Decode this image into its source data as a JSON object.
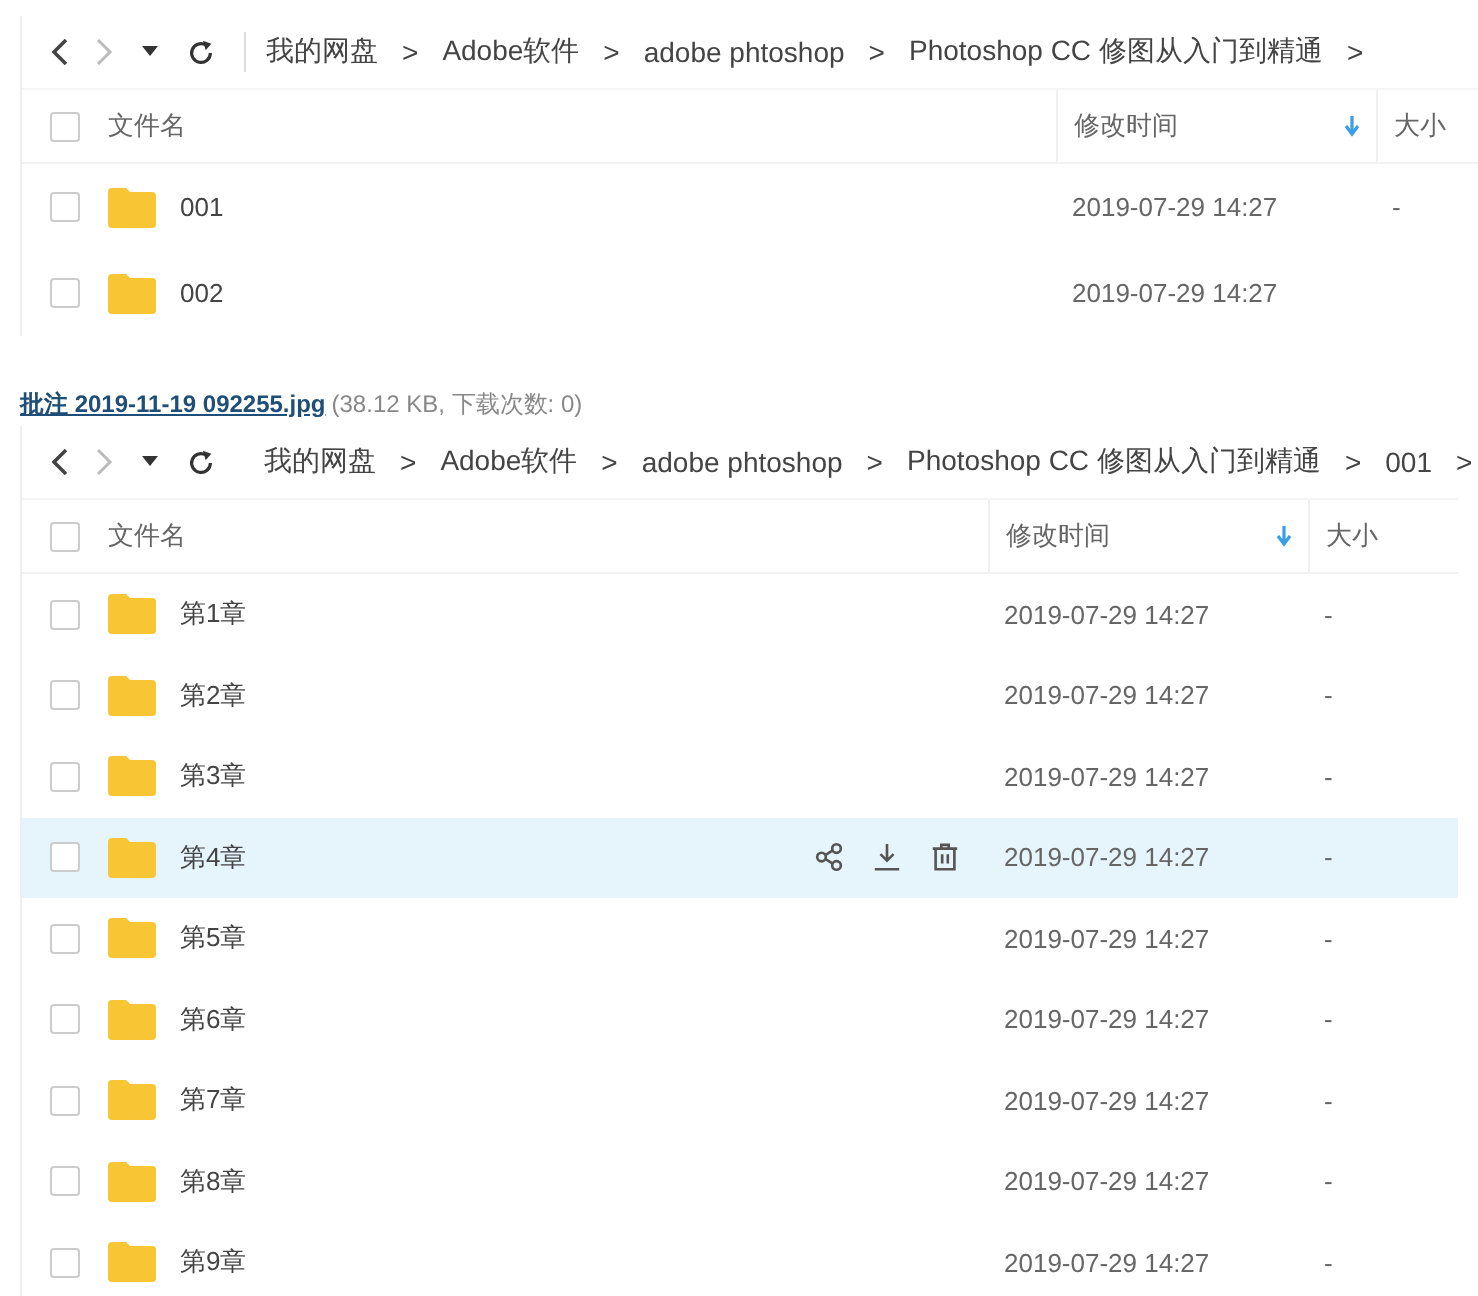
{
  "panels": [
    {
      "breadcrumb": [
        {
          "label": "我的网盘",
          "separator": ">"
        },
        {
          "label": "Adobe软件",
          "separator": ">"
        },
        {
          "label": "adobe phtoshop",
          "separator": ">"
        },
        {
          "label": "Photoshop CC 修图从入门到精通",
          "separator": ">"
        }
      ],
      "columns": [
        {
          "label": "文件名",
          "checked": false
        },
        {
          "label": "修改时间",
          "sorted": true
        },
        {
          "label": "大小"
        }
      ],
      "rows": [
        {
          "name": "001",
          "modified": "2019-07-29 14:27",
          "size": "-",
          "hovered": false,
          "checked": false
        },
        {
          "name": "002",
          "modified": "2019-07-29 14:27",
          "hovered": false,
          "checked": false
        }
      ]
    },
    {
      "caption": {
        "link": "批注 2019-11-19 092255.jpg",
        "meta": "(38.12 KB, 下载次数: 0)"
      },
      "breadcrumb": [
        {
          "label": "我的网盘",
          "separator": ">"
        },
        {
          "label": "Adobe软件",
          "separator": ">"
        },
        {
          "label": "adobe phtoshop",
          "separator": ">"
        },
        {
          "label": "Photoshop CC 修图从入门到精通",
          "separator": ">"
        },
        {
          "label": "001",
          "separator": ">"
        }
      ],
      "columns": [
        {
          "label": "文件名",
          "checked": false
        },
        {
          "label": "修改时间",
          "sorted": true
        },
        {
          "label": "大小"
        }
      ],
      "rows": [
        {
          "name": "第1章",
          "modified": "2019-07-29 14:27",
          "size": "-",
          "hovered": false,
          "checked": false
        },
        {
          "name": "第2章",
          "modified": "2019-07-29 14:27",
          "size": "-",
          "hovered": false,
          "checked": false
        },
        {
          "name": "第3章",
          "modified": "2019-07-29 14:27",
          "size": "-",
          "hovered": false,
          "checked": false
        },
        {
          "name": "第4章",
          "modified": "2019-07-29 14:27",
          "size": "-",
          "hovered": true,
          "checked": false
        },
        {
          "name": "第5章",
          "modified": "2019-07-29 14:27",
          "size": "-",
          "hovered": false,
          "checked": false
        },
        {
          "name": "第6章",
          "modified": "2019-07-29 14:27",
          "size": "-",
          "hovered": false,
          "checked": false
        },
        {
          "name": "第7章",
          "modified": "2019-07-29 14:27",
          "size": "-",
          "hovered": false,
          "checked": false
        },
        {
          "name": "第8章",
          "modified": "2019-07-29 14:27",
          "size": "-",
          "hovered": false,
          "checked": false
        },
        {
          "name": "第9章",
          "modified": "2019-07-29 14:27",
          "size": "-",
          "hovered": false,
          "checked": false
        }
      ]
    }
  ]
}
